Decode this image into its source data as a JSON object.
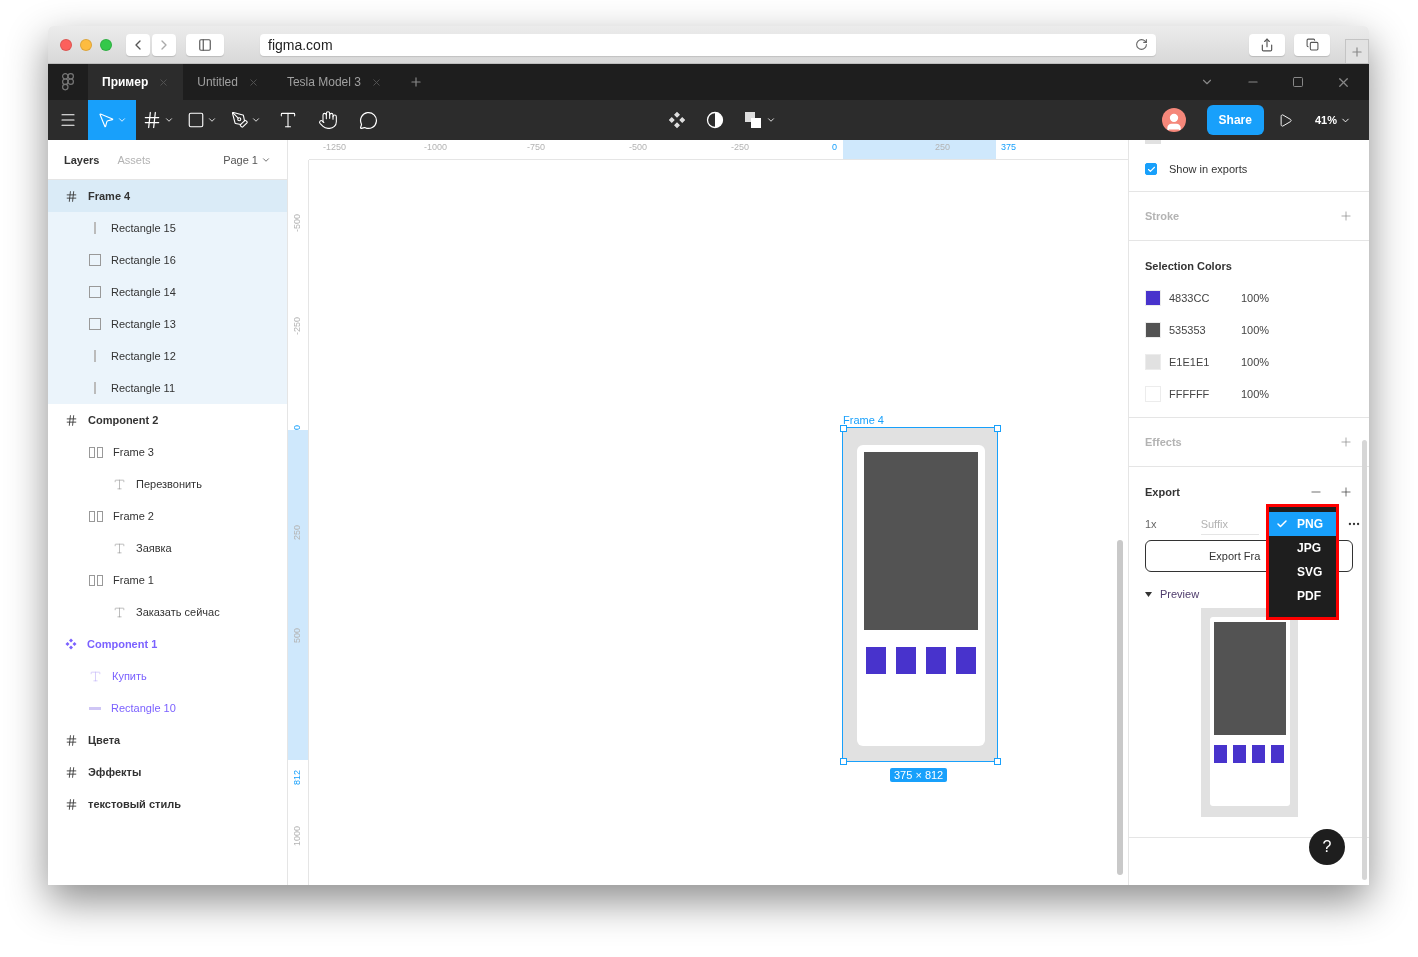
{
  "browser": {
    "url": "figma.com"
  },
  "file_tabs": [
    {
      "label": "Пример",
      "selected": true
    },
    {
      "label": "Untitled",
      "selected": false
    },
    {
      "label": "Tesla Model 3",
      "selected": false
    }
  ],
  "toolbar": {
    "tools": [
      {
        "kind": "move",
        "selected": true
      },
      {
        "kind": "frame",
        "selected": false
      },
      {
        "kind": "shape",
        "selected": false
      },
      {
        "kind": "pen",
        "selected": false
      },
      {
        "kind": "text",
        "selected": false
      },
      {
        "kind": "hand",
        "selected": false
      },
      {
        "kind": "comment",
        "selected": false
      }
    ],
    "share": "Share",
    "zoom": "41%"
  },
  "layers_panel": {
    "tabs": [
      {
        "label": "Layers",
        "selected": true
      },
      {
        "label": "Assets",
        "selected": false
      }
    ],
    "page": "Page 1",
    "layers": [
      {
        "name": "Frame 4",
        "kind": "frame",
        "selected": true,
        "children": [
          {
            "name": "Rectangle 15",
            "kind": "bar",
            "selected": false
          },
          {
            "name": "Rectangle 16",
            "kind": "rect",
            "selected": false
          },
          {
            "name": "Rectangle 14",
            "kind": "rect",
            "selected": false
          },
          {
            "name": "Rectangle 13",
            "kind": "rect",
            "selected": false
          },
          {
            "name": "Rectangle 12",
            "kind": "bar",
            "selected": false
          },
          {
            "name": "Rectangle 11",
            "kind": "bar",
            "selected": false
          }
        ]
      },
      {
        "name": "Component 2",
        "kind": "frame",
        "selected": false,
        "children": [
          {
            "name": "Frame 3",
            "kind": "autolayout",
            "selected": false,
            "children": [
              {
                "name": "Перезвонить",
                "kind": "text",
                "selected": false
              }
            ]
          },
          {
            "name": "Frame 2",
            "kind": "autolayout",
            "selected": false,
            "children": [
              {
                "name": "Заявка",
                "kind": "text",
                "selected": false
              }
            ]
          },
          {
            "name": "Frame 1",
            "kind": "autolayout",
            "selected": false,
            "children": [
              {
                "name": "Заказать сейчас",
                "kind": "text",
                "selected": false
              }
            ]
          }
        ]
      },
      {
        "name": "Component 1",
        "kind": "component",
        "selected": false,
        "children": [
          {
            "name": "Купить",
            "kind": "text",
            "selected": false
          },
          {
            "name": "Rectangle 10",
            "kind": "hbar",
            "selected": false
          }
        ]
      },
      {
        "name": "Цвета",
        "kind": "frame",
        "selected": false
      },
      {
        "name": "Эффекты",
        "kind": "frame",
        "selected": false
      },
      {
        "name": "текстовый стиль",
        "kind": "frame",
        "selected": false
      }
    ]
  },
  "rulers": {
    "top": [
      {
        "label": "-1250",
        "highlighted": false
      },
      {
        "label": "-1000",
        "highlighted": false
      },
      {
        "label": "-750",
        "highlighted": false
      },
      {
        "label": "-500",
        "highlighted": false
      },
      {
        "label": "-250",
        "highlighted": false
      },
      {
        "label": "0",
        "highlighted": true
      },
      {
        "label": "250",
        "highlighted": false
      },
      {
        "label": "375",
        "highlighted": true
      }
    ],
    "left": [
      {
        "label": "-500",
        "highlighted": false
      },
      {
        "label": "-250",
        "highlighted": false
      },
      {
        "label": "0",
        "highlighted": true
      },
      {
        "label": "250",
        "highlighted": false
      },
      {
        "label": "500",
        "highlighted": false
      },
      {
        "label": "812",
        "highlighted": true
      },
      {
        "label": "1000",
        "highlighted": false
      }
    ]
  },
  "canvas": {
    "frame": {
      "name": "Frame 4",
      "size": "375 × 812",
      "selected": true
    }
  },
  "properties": {
    "show_in_exports": {
      "label": "Show in exports",
      "checked": true
    },
    "stroke": {
      "title": "Stroke"
    },
    "selection_colors": {
      "title": "Selection Colors",
      "colors": [
        {
          "hex": "4833CC",
          "opacity": "100%",
          "color": "#4833cc"
        },
        {
          "hex": "535353",
          "opacity": "100%",
          "color": "#535353"
        },
        {
          "hex": "E1E1E1",
          "opacity": "100%",
          "color": "#e1e1e1"
        },
        {
          "hex": "FFFFFF",
          "opacity": "100%",
          "color": "#ffffff"
        }
      ]
    },
    "effects": {
      "title": "Effects"
    },
    "export": {
      "title": "Export",
      "scale": "1x",
      "suffix_placeholder": "Suffix",
      "button": "Export Fra",
      "preview": "Preview",
      "preview_expanded": true
    }
  },
  "format_menu": {
    "items": [
      {
        "label": "PNG",
        "selected": true
      },
      {
        "label": "JPG",
        "selected": false
      },
      {
        "label": "SVG",
        "selected": false
      },
      {
        "label": "PDF",
        "selected": false
      }
    ]
  },
  "help": "?"
}
